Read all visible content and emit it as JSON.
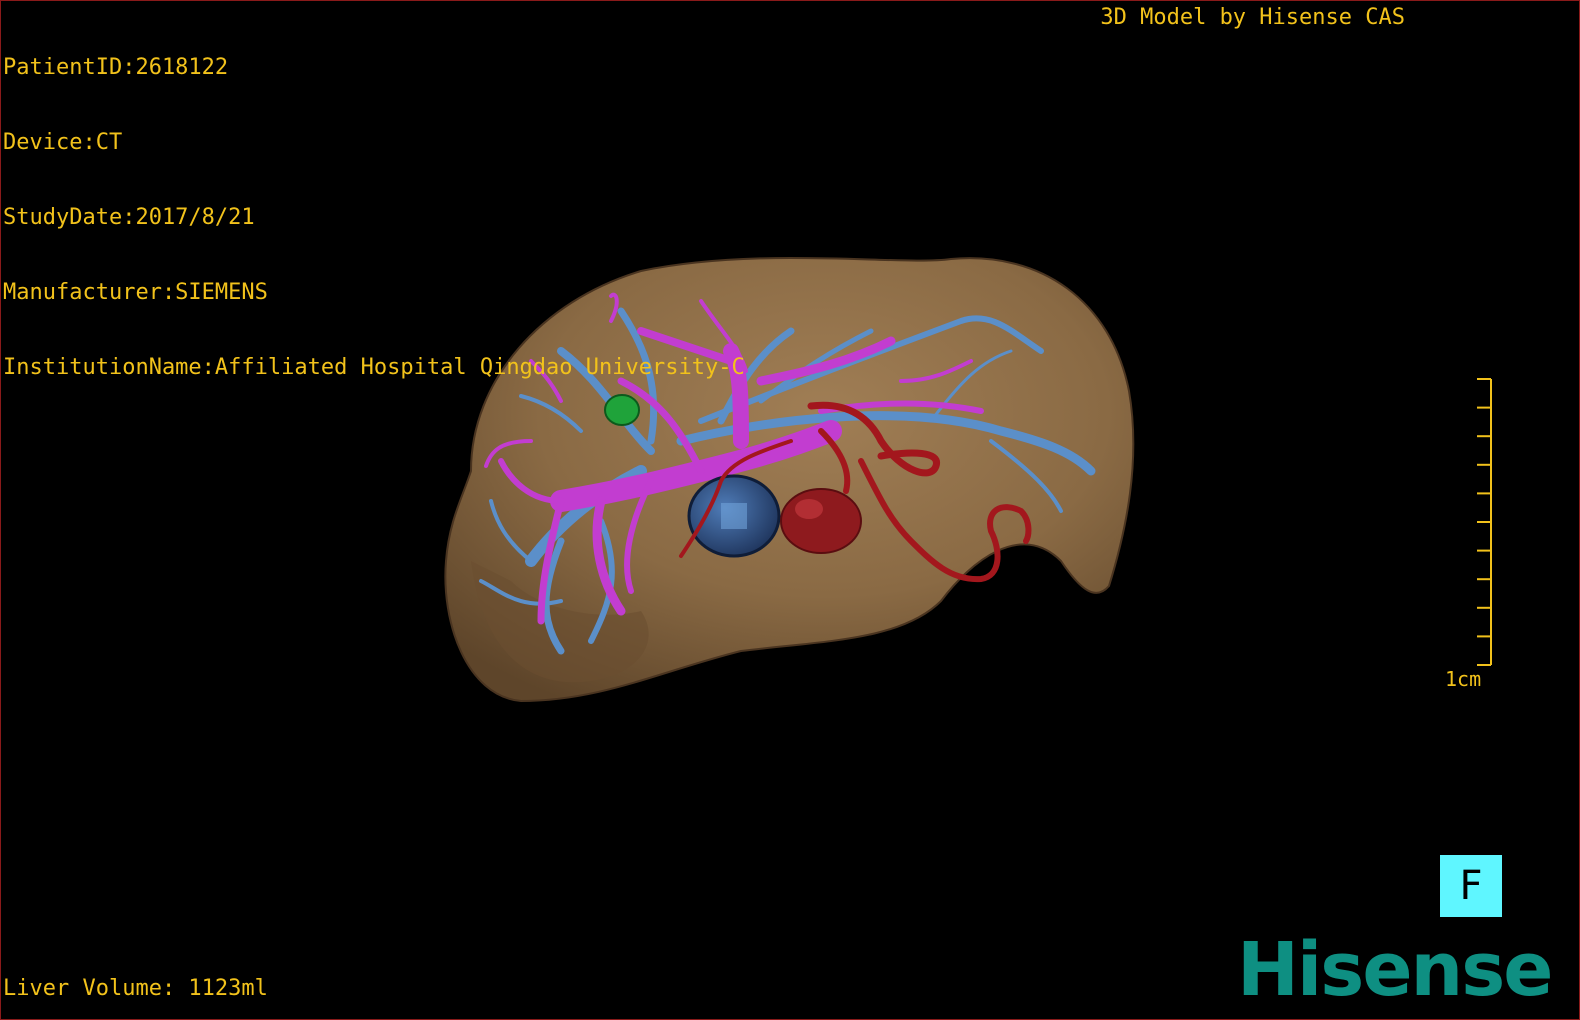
{
  "header": {
    "patient_id": "PatientID:2618122",
    "device": "Device:CT",
    "study_date": "StudyDate:2017/8/21",
    "manufacturer": "Manufacturer:SIEMENS",
    "institution": "InstitutionName:Affiliated Hospital Qingdao University-C"
  },
  "credit": "3D Model by Hisense CAS",
  "footer": {
    "liver_volume": "Liver Volume: 1123ml"
  },
  "scale": {
    "label": "1cm",
    "tick_count": 10
  },
  "orientation": {
    "label": "F"
  },
  "brand": {
    "logo_text": "Hisense"
  },
  "colors": {
    "overlay_text": "#f2c21b",
    "liver_surface": "#8a6a44",
    "hepatic_vein": "#5b8fc9",
    "portal_vein": "#c23dd0",
    "artery": "#a3171d",
    "tumor": "#1fa33a",
    "orientation_box": "#5ff6ff",
    "brand": "#0e8f82"
  },
  "model": {
    "structures": [
      "liver-surface",
      "hepatic-veins",
      "portal-veins",
      "hepatic-artery",
      "tumor",
      "inferior-vena-cava"
    ]
  }
}
